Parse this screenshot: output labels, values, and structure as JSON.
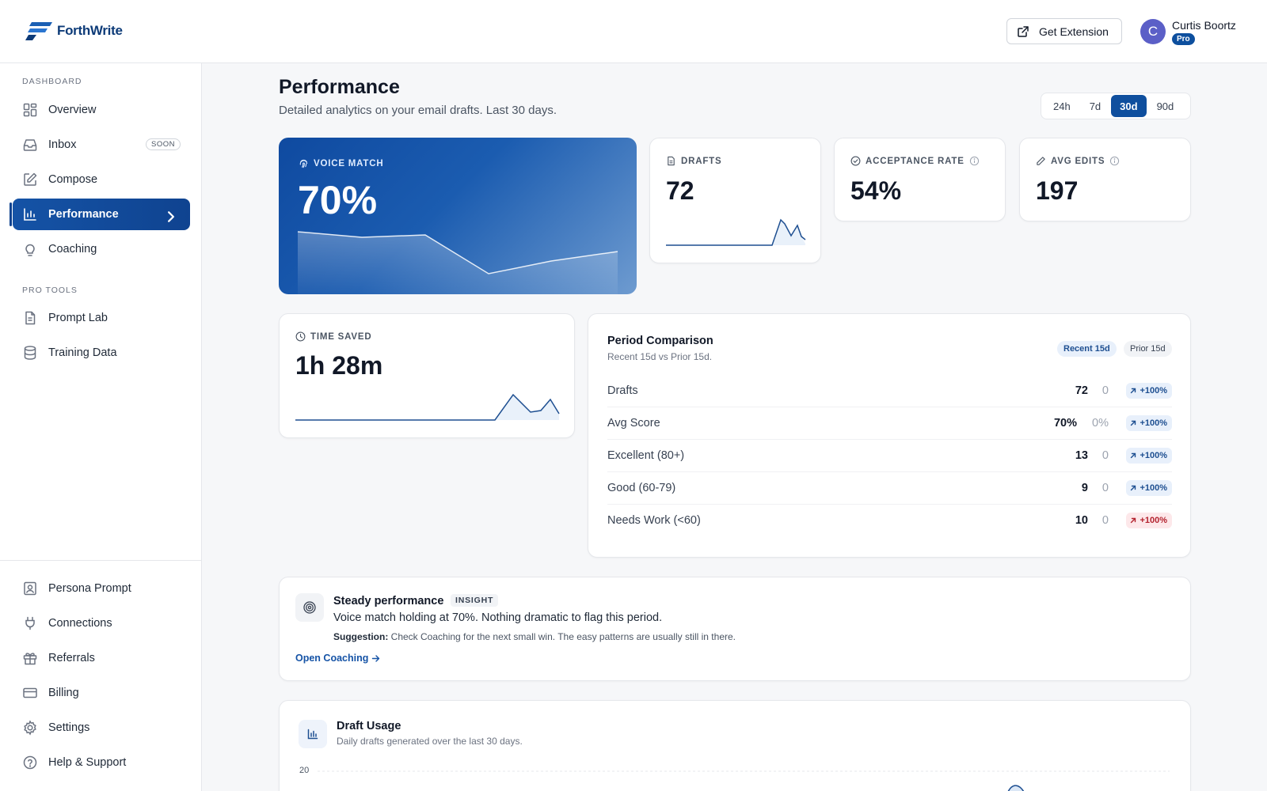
{
  "app": {
    "logo_text": "ForthWrite"
  },
  "header": {
    "extension_label": "Get Extension",
    "user": {
      "initial": "C",
      "name": "Curtis Boortz",
      "plan": "Pro"
    }
  },
  "sidebar": {
    "section_dashboard": "DASHBOARD",
    "section_pro": "PRO TOOLS",
    "items": [
      {
        "label": "Overview",
        "icon": "grid-icon"
      },
      {
        "label": "Inbox",
        "icon": "inbox-icon",
        "badge": "SOON"
      },
      {
        "label": "Compose",
        "icon": "edit-icon"
      },
      {
        "label": "Performance",
        "icon": "bar-chart-icon",
        "active": true
      },
      {
        "label": "Coaching",
        "icon": "lightbulb-icon"
      }
    ],
    "pro_items": [
      {
        "label": "Prompt Lab",
        "icon": "document-icon"
      },
      {
        "label": "Training Data",
        "icon": "database-icon"
      }
    ],
    "bottom_items": [
      {
        "label": "Persona Prompt",
        "icon": "persona-icon"
      },
      {
        "label": "Connections",
        "icon": "plug-icon"
      },
      {
        "label": "Referrals",
        "icon": "gift-icon"
      },
      {
        "label": "Billing",
        "icon": "credit-card-icon"
      },
      {
        "label": "Settings",
        "icon": "gear-icon"
      },
      {
        "label": "Help & Support",
        "icon": "help-icon"
      }
    ]
  },
  "page": {
    "title": "Performance",
    "subtitle": "Detailed analytics on your email drafts. Last 30 days.",
    "ranges": [
      "24h",
      "7d",
      "30d",
      "90d"
    ],
    "active_range": "30d"
  },
  "metrics": {
    "voice_match": {
      "label": "VOICE MATCH",
      "value": "70%"
    },
    "drafts": {
      "label": "DRAFTS",
      "value": "72"
    },
    "acceptance": {
      "label": "ACCEPTANCE RATE",
      "value": "54%"
    },
    "avg_edits": {
      "label": "AVG EDITS",
      "value": "197"
    },
    "time_saved": {
      "label": "TIME SAVED",
      "value": "1h 28m"
    }
  },
  "comparison": {
    "title": "Period Comparison",
    "subtitle": "Recent 15d vs Prior 15d.",
    "tag_recent": "Recent 15d",
    "tag_prior": "Prior 15d",
    "rows": [
      {
        "label": "Drafts",
        "current": "72",
        "prior": "0",
        "delta": "+100%",
        "trend": "up"
      },
      {
        "label": "Avg Score",
        "current": "70%",
        "prior": "0%",
        "delta": "+100%",
        "trend": "up"
      },
      {
        "label": "Excellent (80+)",
        "current": "13",
        "prior": "0",
        "delta": "+100%",
        "trend": "up"
      },
      {
        "label": "Good (60-79)",
        "current": "9",
        "prior": "0",
        "delta": "+100%",
        "trend": "up"
      },
      {
        "label": "Needs Work (<60)",
        "current": "10",
        "prior": "0",
        "delta": "+100%",
        "trend": "down"
      }
    ]
  },
  "insight": {
    "title": "Steady performance",
    "tag": "INSIGHT",
    "body": "Voice match holding at 70%. Nothing dramatic to flag this period.",
    "suggestion_label": "Suggestion:",
    "suggestion": "Check Coaching for the next small win. The easy patterns are usually still in there.",
    "link": "Open Coaching"
  },
  "draft_usage": {
    "title": "Draft Usage",
    "subtitle": "Daily drafts generated over the last 30 days.",
    "y_tick": "20"
  },
  "colors": {
    "accent": "#0f4f9e",
    "danger": "#b4232f"
  }
}
